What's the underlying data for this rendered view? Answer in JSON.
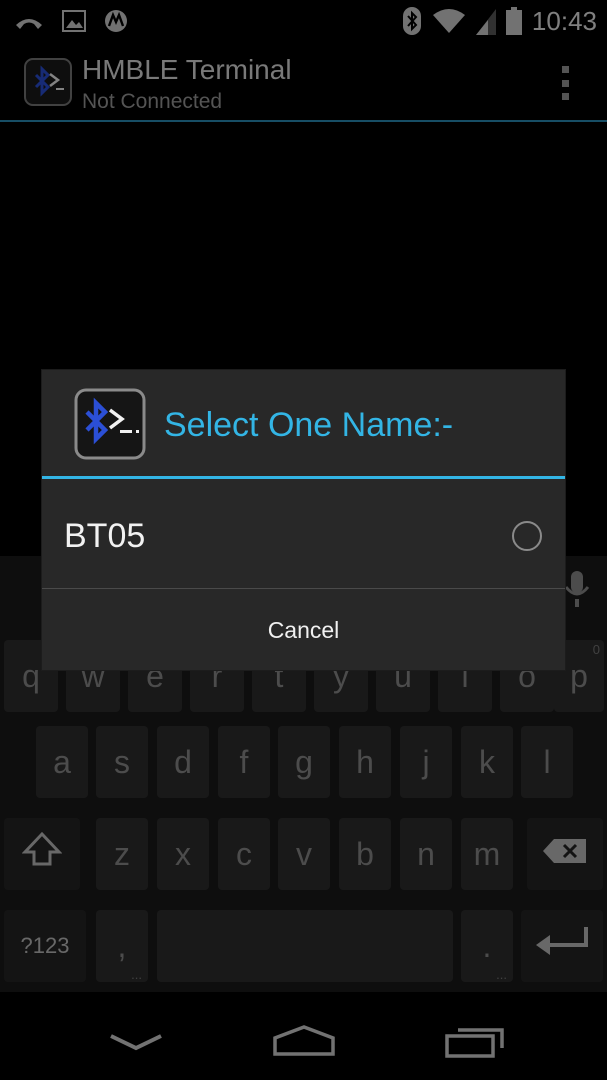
{
  "status_bar": {
    "time": "10:43",
    "left_icons": [
      "missed-call-icon",
      "image-icon",
      "motorola-icon"
    ],
    "right_icons": [
      "bluetooth-icon",
      "wifi-icon",
      "signal-icon",
      "battery-icon"
    ]
  },
  "action_bar": {
    "title": "HMBLE Terminal",
    "subtitle": "Not Connected",
    "accent_color": "#2a8fb8"
  },
  "dialog": {
    "title": "Select One Name:-",
    "title_color": "#33b5e5",
    "items": [
      {
        "label": "BT05",
        "selected": false
      }
    ],
    "cancel_label": "Cancel"
  },
  "keyboard": {
    "row1": [
      "q",
      "w",
      "e",
      "r",
      "t",
      "y",
      "u",
      "i",
      "o",
      "p"
    ],
    "row1_hint_p": "0",
    "row2": [
      "a",
      "s",
      "d",
      "f",
      "g",
      "h",
      "j",
      "k",
      "l"
    ],
    "row3": [
      "z",
      "x",
      "c",
      "v",
      "b",
      "n",
      "m"
    ],
    "symbols_key": "?123",
    "comma_key": ",",
    "period_key": ".",
    "hint_dots": "..."
  },
  "nav_bar": {
    "buttons": [
      "back-icon",
      "home-icon",
      "recents-icon"
    ]
  }
}
